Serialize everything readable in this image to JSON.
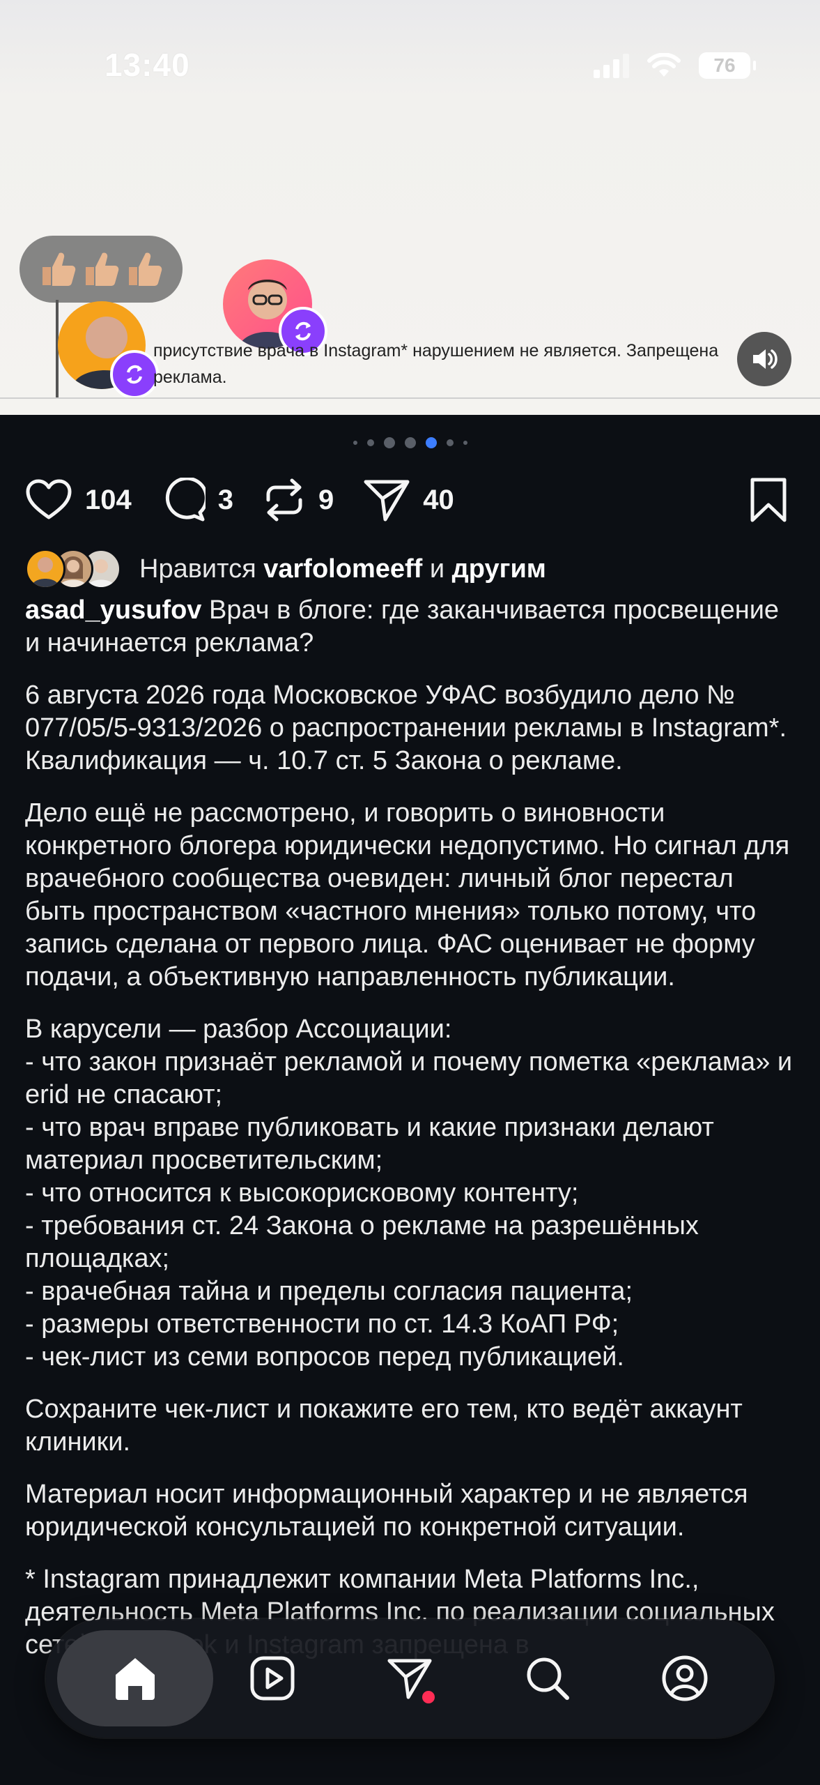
{
  "status_bar": {
    "time": "13:40",
    "battery": "76"
  },
  "media": {
    "emoji_reaction": "👍🏼👍🏼👍🏼",
    "caption_snippet": "присутствие врача в Instagram* нарушением не является. Запрещена реклама.",
    "sound_icon": "speaker-icon"
  },
  "carousel": {
    "dot_count": 7,
    "active_index": 4
  },
  "actions": {
    "likes": "104",
    "comments": "3",
    "reposts": "9",
    "shares": "40"
  },
  "liked_by": {
    "prefix": "Нравится ",
    "user": "varfolomeeff",
    "middle": " и ",
    "others": "другим"
  },
  "post": {
    "author": "asad_yusufov",
    "title": " Врач в блоге: где заканчивается просвещение и начинается реклама?",
    "paragraphs": [
      "6 августа 2026 года Московское УФАС возбудило дело № 077/05/5-9313/2026 о распространении рекламы в Instagram*. Квалификация — ч. 10.7 ст. 5 Закона о рекламе.",
      "Дело ещё не рассмотрено, и говорить о виновности конкретного блогера юридически недопустимо. Но сигнал для врачебного сообщества очевиден: личный блог перестал быть пространством «частного мнения» только потому, что запись сделана от первого лица. ФАС оценивает не форму подачи, а объективную направленность публикации.",
      "В карусели — разбор Ассоциации:\n- что закон признаёт рекламой и почему пометка «реклама» и erid не спасают;\n-  что врач вправе публиковать и какие признаки делают материал просветительским;\n- что относится к высокорисковому контенту;\n- требования ст. 24 Закона о рекламе на разрешённых площадках;\n- врачебная тайна и пределы согласия пациента;\n- размеры ответственности по ст. 14.3 КоАП РФ;\n- чек-лист из семи вопросов перед публикацией.",
      "Сохраните чек-лист и покажите его тем, кто ведёт аккаунт клиники.",
      "Материал носит информационный характер и не является юридической консультацией по конкретной ситуации.",
      "* Instagram принадлежит компании Meta Platforms Inc., деятельность Meta Platforms Inc. по реализации социальных сетей Facebook и Instagram запрещена в"
    ]
  },
  "bottom_nav": {
    "items": [
      "home-icon",
      "reels-icon",
      "send-icon",
      "search-icon",
      "profile-icon"
    ],
    "accent": "#ff2d55"
  }
}
